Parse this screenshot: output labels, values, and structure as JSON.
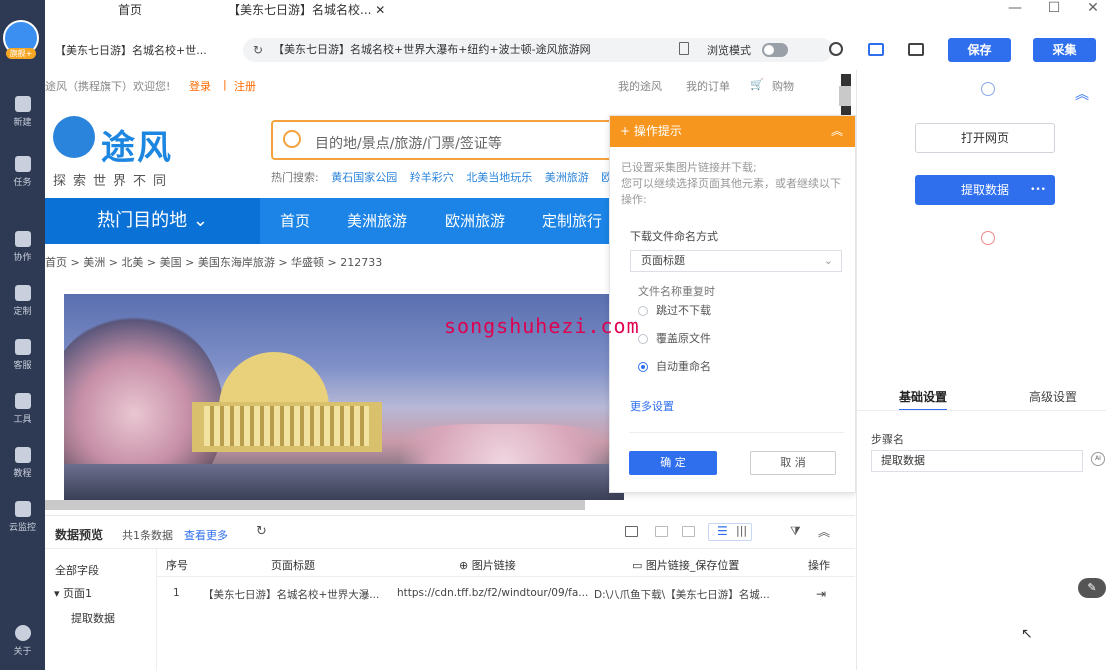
{
  "sidebar": {
    "badge": "旗舰+",
    "items": [
      {
        "label": "新建",
        "icon": "plus-icon"
      },
      {
        "label": "任务",
        "icon": "task-icon"
      },
      {
        "label": "协作",
        "icon": "users-icon"
      },
      {
        "label": "定制",
        "icon": "custom-icon"
      },
      {
        "label": "客服",
        "icon": "headset-icon"
      },
      {
        "label": "工具",
        "icon": "toolbox-icon"
      },
      {
        "label": "教程",
        "icon": "tutorial-icon"
      },
      {
        "label": "云监控",
        "icon": "cloud-icon"
      },
      {
        "label": "关于",
        "icon": "info-icon"
      }
    ]
  },
  "tabs": [
    {
      "label": "首页"
    },
    {
      "label": "【美东七日游】名城名校...",
      "close": "✕"
    }
  ],
  "window_controls": {
    "minimize": "—",
    "maximize": "☐",
    "close": "✕"
  },
  "address": {
    "tab_label": "【美东七日游】名城名校+世...",
    "url": "【美东七日游】名城名校+世界大瀑布+纽约+波士顿-途风旅游网",
    "browse_mode": "浏览模式"
  },
  "toolbar": {
    "save": "保存",
    "collect": "采集"
  },
  "site": {
    "welcome": "途风（携程旗下）欢迎您!",
    "login": "登录",
    "sep": "|",
    "register": "注册",
    "my_tuufun": "我的途风",
    "my_orders": "我的订单",
    "cart": "购物",
    "logo_text": "途风",
    "slogan": "探索世界不同",
    "search_placeholder": "目的地/景点/旅游/门票/签证等",
    "hot_label": "热门搜索:",
    "hot_items": [
      "黄石国家公园",
      "羚羊彩穴",
      "北美当地玩乐",
      "美洲旅游",
      "欧"
    ],
    "hot_dest": "热门目的地",
    "nav": [
      "首页",
      "美洲旅游",
      "欧洲旅游",
      "定制旅行"
    ],
    "breadcrumb": "首页 > 美洲 > 北美 > 美国 > 美国东海岸旅游 > 华盛顿 > 212733"
  },
  "popup": {
    "title": "操作提示",
    "desc": "已设置采集图片链接并下载;\n您可以继续选择页面其他元素，或者继续以下操作:",
    "naming_label": "下载文件命名方式",
    "naming_value": "页面标题",
    "dup_label": "文件名称重复时",
    "options": [
      "跳过不下载",
      "覆盖原文件",
      "自动重命名"
    ],
    "selected": "自动重命名",
    "more": "更多设置",
    "ok": "确 定",
    "cancel": "取 消"
  },
  "watermark": "songshuhezi.com",
  "flow": {
    "open_page": "打开网页",
    "extract": "提取数据",
    "more_dots": "•••"
  },
  "settings": {
    "tab_basic": "基础设置",
    "tab_advanced": "高级设置",
    "step_label": "步骤名",
    "step_value": "提取数据",
    "help_icon": "AI"
  },
  "preview": {
    "title": "数据预览",
    "count": "共1条数据",
    "more": "查看更多",
    "tree_all": "全部字段",
    "tree_page": "页面1",
    "tree_extract": "提取数据",
    "columns": [
      "序号",
      "页面标题",
      "图片链接",
      "图片链接_保存位置",
      "操作"
    ],
    "rows": [
      [
        "1",
        "【美东七日游】名城名校+世界大瀑...",
        "https://cdn.tff.bz/f2/windtour/09/fa...",
        "D:\\八爪鱼下载\\【美东七日游】名城..."
      ]
    ]
  },
  "colors": {
    "accent": "#2f6fed",
    "orange": "#f7961e",
    "sidebar": "#2e3a54",
    "site_blue": "#1b84e6"
  }
}
